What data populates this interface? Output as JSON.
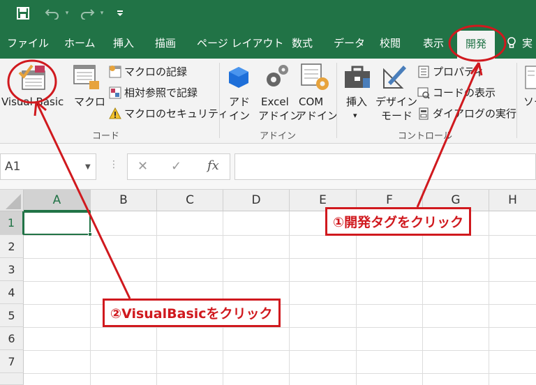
{
  "qat": {
    "save_icon": "save-icon",
    "undo_icon": "undo-icon",
    "redo_icon": "redo-icon",
    "customize_icon": "customize-qat-icon"
  },
  "tabs": [
    {
      "label": "ファイル"
    },
    {
      "label": "ホーム"
    },
    {
      "label": "挿入"
    },
    {
      "label": "描画"
    },
    {
      "label": "ページ レイアウト"
    },
    {
      "label": "数式"
    },
    {
      "label": "データ"
    },
    {
      "label": "校閲"
    },
    {
      "label": "表示"
    },
    {
      "label": "開発",
      "active": true
    },
    {
      "label": "実"
    }
  ],
  "ribbon": {
    "code": {
      "group_label": "コード",
      "visual_basic": "Visual Basic",
      "macro": "マクロ",
      "record_macro": "マクロの記録",
      "relative_ref": "相対参照で記録",
      "macro_security": "マクロのセキュリティ"
    },
    "addins": {
      "group_label": "アドイン",
      "addin_line1": "アド",
      "addin_line2": "イン",
      "excel_line1": "Excel",
      "excel_line2": "アドイン",
      "com_line1": "COM",
      "com_line2": "アドイン"
    },
    "controls": {
      "group_label": "コントロール",
      "insert": "挿入",
      "insert_arrow": "▾",
      "design_line1": "デザイン",
      "design_line2": "モード",
      "properties": "プロパティ",
      "view_code": "コードの表示",
      "run_dialog": "ダイアログの実行"
    },
    "source_partial": "ソー"
  },
  "formula_bar": {
    "name_box_value": "A1",
    "cancel_glyph": "✕",
    "enter_glyph": "✓",
    "fx_label": "fx",
    "formula_value": ""
  },
  "grid": {
    "columns": [
      "A",
      "B",
      "C",
      "D",
      "E",
      "F",
      "G",
      "H"
    ],
    "rows": [
      "1",
      "2",
      "3",
      "4",
      "5",
      "6",
      "7"
    ],
    "selected_cell": "A1"
  },
  "annotations": {
    "step1": "①開発タグをクリック",
    "step2": "②VisualBasicをクリック",
    "color": "#d0191e"
  },
  "colors": {
    "excel_green": "#217346",
    "ribbon_bg": "#f3f3f3"
  }
}
